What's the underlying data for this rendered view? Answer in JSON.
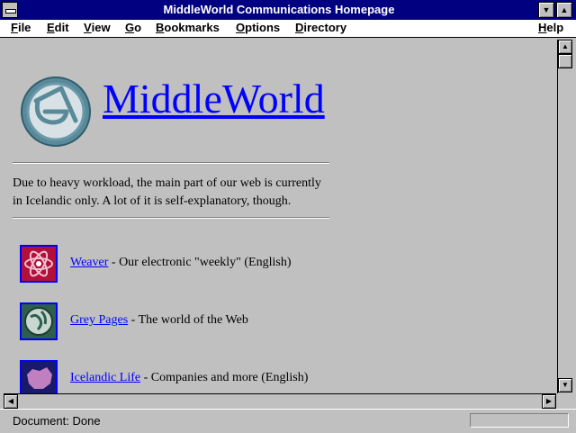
{
  "window": {
    "title": "MiddleWorld Communications Homepage"
  },
  "menu": [
    {
      "label": "File",
      "accel": "F"
    },
    {
      "label": "Edit",
      "accel": "E"
    },
    {
      "label": "View",
      "accel": "V"
    },
    {
      "label": "Go",
      "accel": "G"
    },
    {
      "label": "Bookmarks",
      "accel": "B"
    },
    {
      "label": "Options",
      "accel": "O"
    },
    {
      "label": "Directory",
      "accel": "D"
    },
    {
      "label": "Help",
      "accel": "H"
    }
  ],
  "page": {
    "brand": "MiddleWorld",
    "notice_line1": "Due to heavy workload, the main part of our web is currently",
    "notice_line2": "in Icelandic only. A lot of it is self-explanatory, though.",
    "items": [
      {
        "link": "Weaver",
        "desc": " - Our electronic \"weekly\" (English)",
        "icon": "atom-icon"
      },
      {
        "link": "Grey Pages",
        "desc": " - The world of the Web",
        "icon": "globe-icon"
      },
      {
        "link": "Icelandic Life",
        "desc": " - Companies and more (English)",
        "icon": "iceland-map-icon"
      }
    ]
  },
  "status": {
    "text": "Document: Done"
  },
  "colors": {
    "titlebar": "#000080",
    "link": "#0000ff",
    "chrome": "#c0c0c0"
  }
}
